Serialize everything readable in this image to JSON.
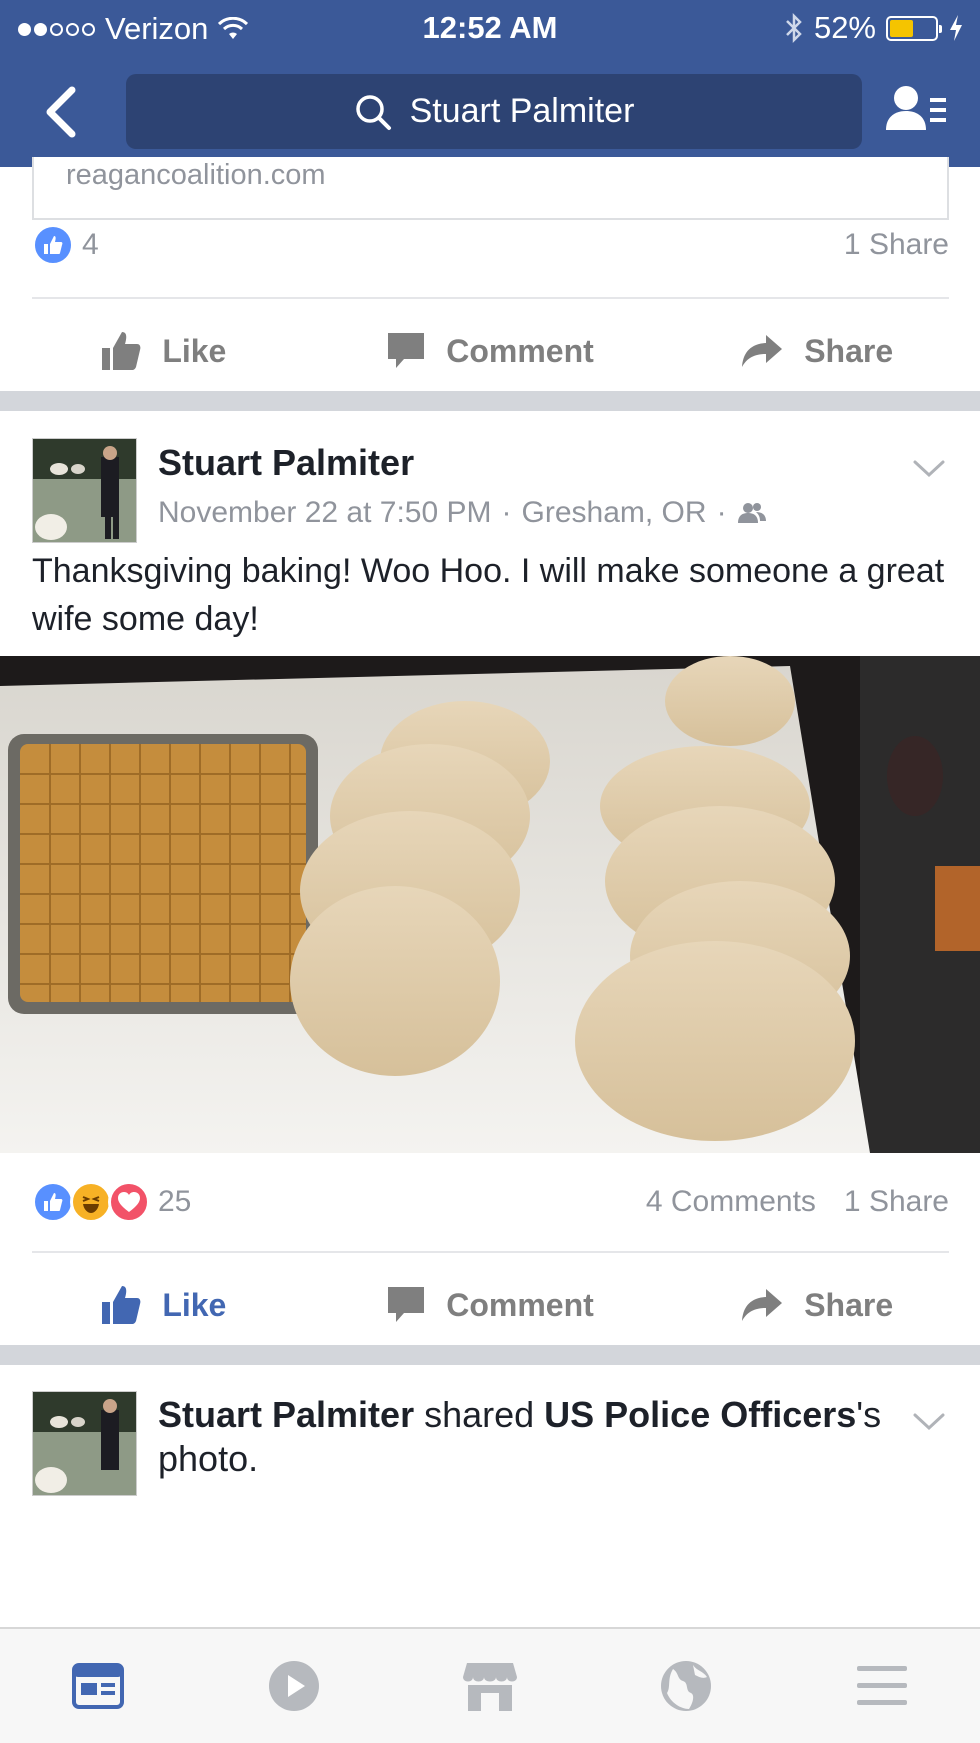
{
  "status_bar": {
    "carrier": "Verizon",
    "time": "12:52 AM",
    "battery": "52%",
    "battery_level": 0.52
  },
  "search": {
    "query": "Stuart Palmiter"
  },
  "previous_post": {
    "link_domain": "reagancoalition.com",
    "like_count": "4",
    "shares": "1 Share",
    "actions": {
      "like": "Like",
      "comment": "Comment",
      "share": "Share"
    }
  },
  "post": {
    "author": "Stuart Palmiter",
    "date": "November 22 at 7:50 PM",
    "location": "Gresham, OR",
    "text": "Thanksgiving baking!  Woo Hoo.  I will make someone a great wife some day!",
    "reaction_count": "25",
    "comments": "4 Comments",
    "shares": "1 Share",
    "actions": {
      "like": "Like",
      "comment": "Comment",
      "share": "Share"
    }
  },
  "next_post": {
    "author": "Stuart Palmiter",
    "verb": " shared ",
    "page_name": "US Police Officers",
    "suffix_possessive": "'s",
    "suffix": " photo."
  },
  "colors": {
    "brand": "#3b5998",
    "like_active": "#4267b2"
  },
  "tabbar": {
    "icons": [
      "news-feed-icon",
      "video-icon",
      "marketplace-icon",
      "notifications-globe-icon",
      "menu-icon"
    ]
  }
}
